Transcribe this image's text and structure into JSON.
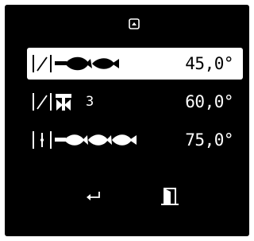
{
  "colors": {
    "background": "#000000",
    "foreground": "#ffffff",
    "selected_bg": "#ffffff",
    "selected_fg": "#000000"
  },
  "nav": {
    "up_icon": "scroll-up-icon"
  },
  "items": [
    {
      "symbol": "angled-stitch-fish-pattern-icon",
      "value": "45,0°",
      "selected": true
    },
    {
      "symbol": "angled-stitch-presser-foot-icon",
      "count": "3",
      "value": "60,0°",
      "selected": false
    },
    {
      "symbol": "straight-stitch-triple-fish-pattern-icon",
      "value": "75,0°",
      "selected": false
    }
  ],
  "footer": {
    "enter_icon": "enter-icon",
    "exit_icon": "exit-door-icon"
  }
}
